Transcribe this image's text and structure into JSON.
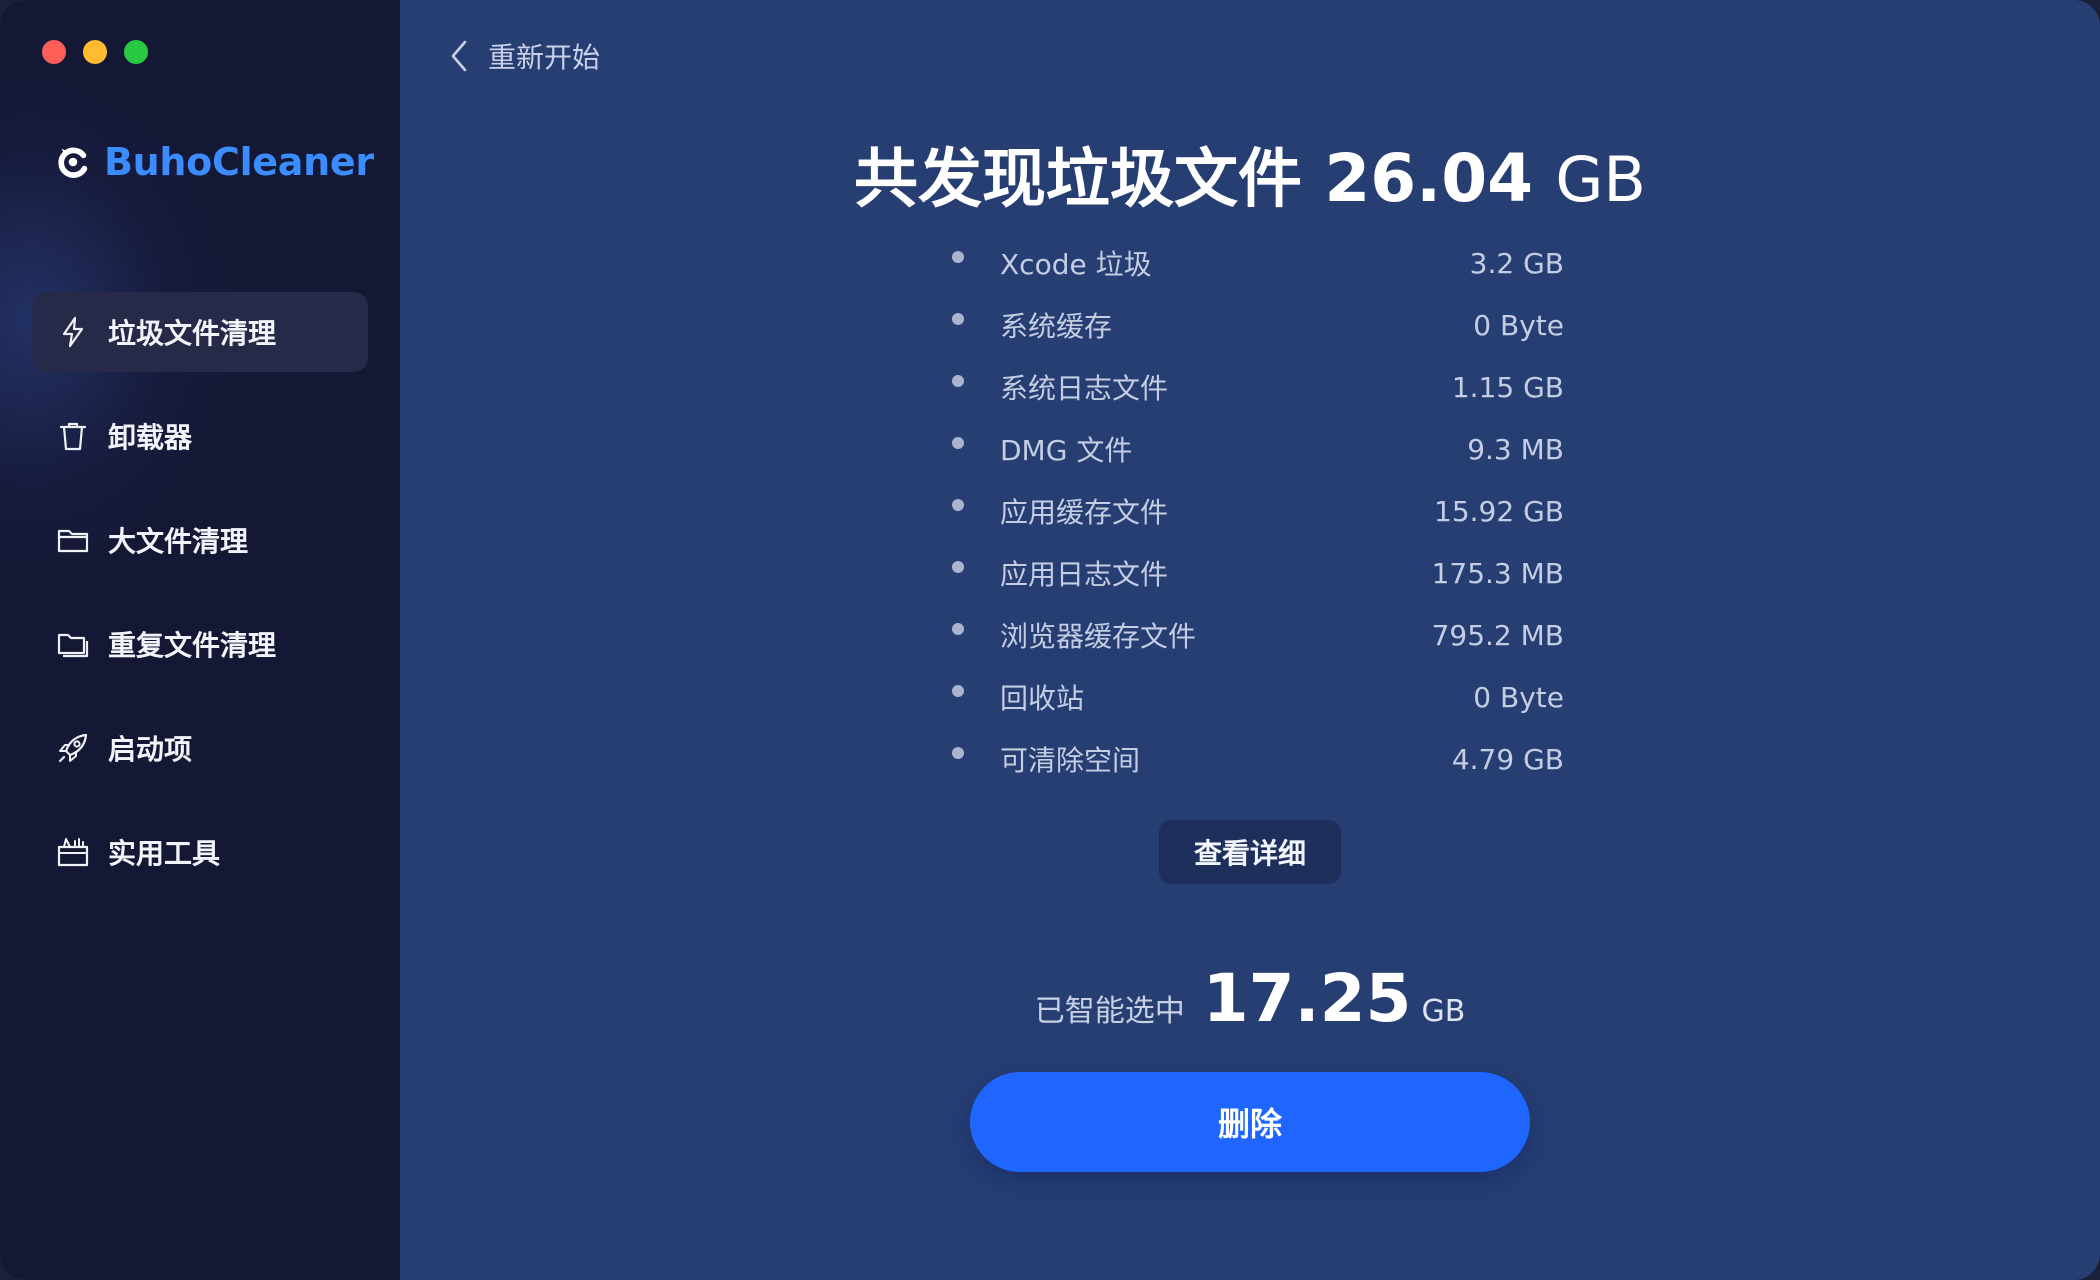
{
  "window": {
    "traffic_lights": [
      {
        "name": "close",
        "color": "#fe5f57"
      },
      {
        "name": "minimize",
        "color": "#febc2e"
      },
      {
        "name": "maximize",
        "color": "#28c840"
      }
    ]
  },
  "brand": {
    "name": "BuhoCleaner",
    "color": "#3b8cff",
    "icon": "buho-logo-icon"
  },
  "sidebar": {
    "items": [
      {
        "label": "垃圾文件清理",
        "icon": "lightning-icon",
        "active": true
      },
      {
        "label": "卸载器",
        "icon": "trash-icon",
        "active": false
      },
      {
        "label": "大文件清理",
        "icon": "folder-icon",
        "active": false
      },
      {
        "label": "重复文件清理",
        "icon": "duplicate-folder-icon",
        "active": false
      },
      {
        "label": "启动项",
        "icon": "rocket-icon",
        "active": false
      },
      {
        "label": "实用工具",
        "icon": "toolbox-icon",
        "active": false
      }
    ]
  },
  "header": {
    "back_label": "重新开始"
  },
  "summary": {
    "title_prefix": "共发现垃圾文件",
    "total_value": "26.04",
    "total_unit": "GB"
  },
  "items": [
    {
      "label": "Xcode 垃圾",
      "size": "3.2 GB"
    },
    {
      "label": "系统缓存",
      "size": "0 Byte"
    },
    {
      "label": "系统日志文件",
      "size": "1.15 GB"
    },
    {
      "label": "DMG 文件",
      "size": "9.3 MB"
    },
    {
      "label": "应用缓存文件",
      "size": "15.92 GB"
    },
    {
      "label": "应用日志文件",
      "size": "175.3 MB"
    },
    {
      "label": "浏览器缓存文件",
      "size": "795.2 MB"
    },
    {
      "label": "回收站",
      "size": "0 Byte"
    },
    {
      "label": "可清除空间",
      "size": "4.79 GB"
    }
  ],
  "details_button": "查看详细",
  "selection": {
    "label": "已智能选中",
    "value": "17.25",
    "unit": "GB"
  },
  "delete_button": "删除",
  "colors": {
    "main_bg": "#263e72",
    "sidebar_bg": "#151834",
    "accent_button": "#1f66ff"
  }
}
